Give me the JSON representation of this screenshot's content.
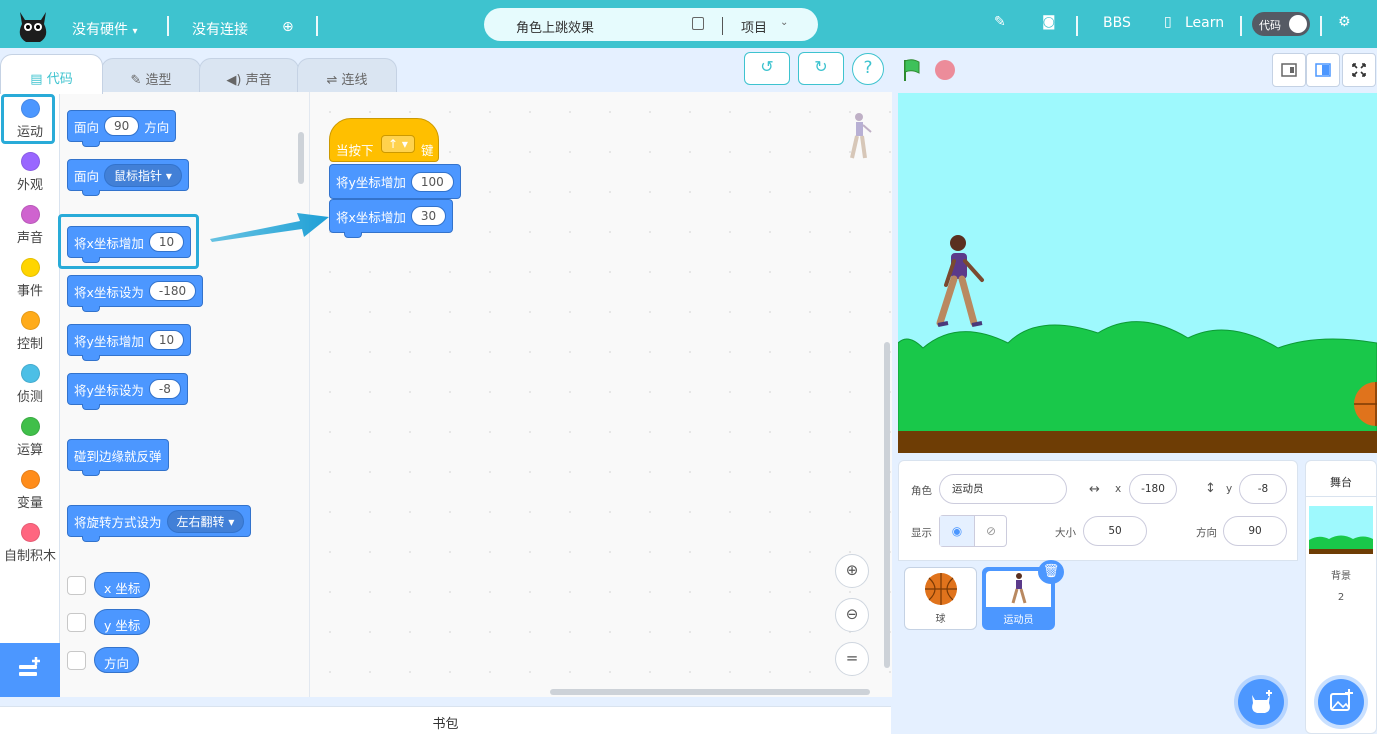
{
  "topbar": {
    "hardware": "没有硬件",
    "connection": "没有连接",
    "project_title": "角色上跳效果",
    "project_menu": "项目",
    "bbs": "BBS",
    "learn": "Learn",
    "mode_toggle": "代码"
  },
  "tabs": [
    {
      "label": "代码",
      "icon": "code-icon"
    },
    {
      "label": "造型",
      "icon": "brush-icon"
    },
    {
      "label": "声音",
      "icon": "speaker-icon"
    },
    {
      "label": "连线",
      "icon": "wire-icon"
    }
  ],
  "categories": [
    {
      "label": "运动",
      "color": "#4c97ff"
    },
    {
      "label": "外观",
      "color": "#9966ff"
    },
    {
      "label": "声音",
      "color": "#cf63cf"
    },
    {
      "label": "事件",
      "color": "#ffd500"
    },
    {
      "label": "控制",
      "color": "#ffab19"
    },
    {
      "label": "侦测",
      "color": "#4cbfe6"
    },
    {
      "label": "运算",
      "color": "#40bf4a"
    },
    {
      "label": "变量",
      "color": "#ff8c1a"
    },
    {
      "label": "自制积木",
      "color": "#ff6680"
    }
  ],
  "palette": {
    "point_in_direction": {
      "label": "面向",
      "value": "90",
      "suffix": "方向"
    },
    "point_towards": {
      "label": "面向",
      "dropdown": "鼠标指针"
    },
    "change_x": {
      "label": "将x坐标增加",
      "value": "10"
    },
    "set_x": {
      "label": "将x坐标设为",
      "value": "-180"
    },
    "change_y": {
      "label": "将y坐标增加",
      "value": "10"
    },
    "set_y": {
      "label": "将y坐标设为",
      "value": "-8"
    },
    "bounce": {
      "label": "碰到边缘就反弹"
    },
    "rotation_style": {
      "label": "将旋转方式设为",
      "dropdown": "左右翻转"
    },
    "reporters": [
      "x 坐标",
      "y 坐标",
      "方向"
    ]
  },
  "script": {
    "hat_label": "当按下",
    "hat_key": "↑",
    "hat_suffix": "键",
    "block1_label": "将y坐标增加",
    "block1_value": "100",
    "block2_label": "将x坐标增加",
    "block2_value": "30"
  },
  "backpack": "书包",
  "sprite_info": {
    "sprite_label": "角色",
    "sprite_name": "运动员",
    "x_label": "x",
    "x_value": "-180",
    "y_label": "y",
    "y_value": "-8",
    "show_label": "显示",
    "size_label": "大小",
    "size_value": "50",
    "direction_label": "方向",
    "direction_value": "90"
  },
  "sprites": [
    {
      "name": "球",
      "selected": false
    },
    {
      "name": "运动员",
      "selected": true
    }
  ],
  "stage_panel": {
    "title": "舞台",
    "backdrop_label": "背景",
    "backdrop_count": "2"
  }
}
